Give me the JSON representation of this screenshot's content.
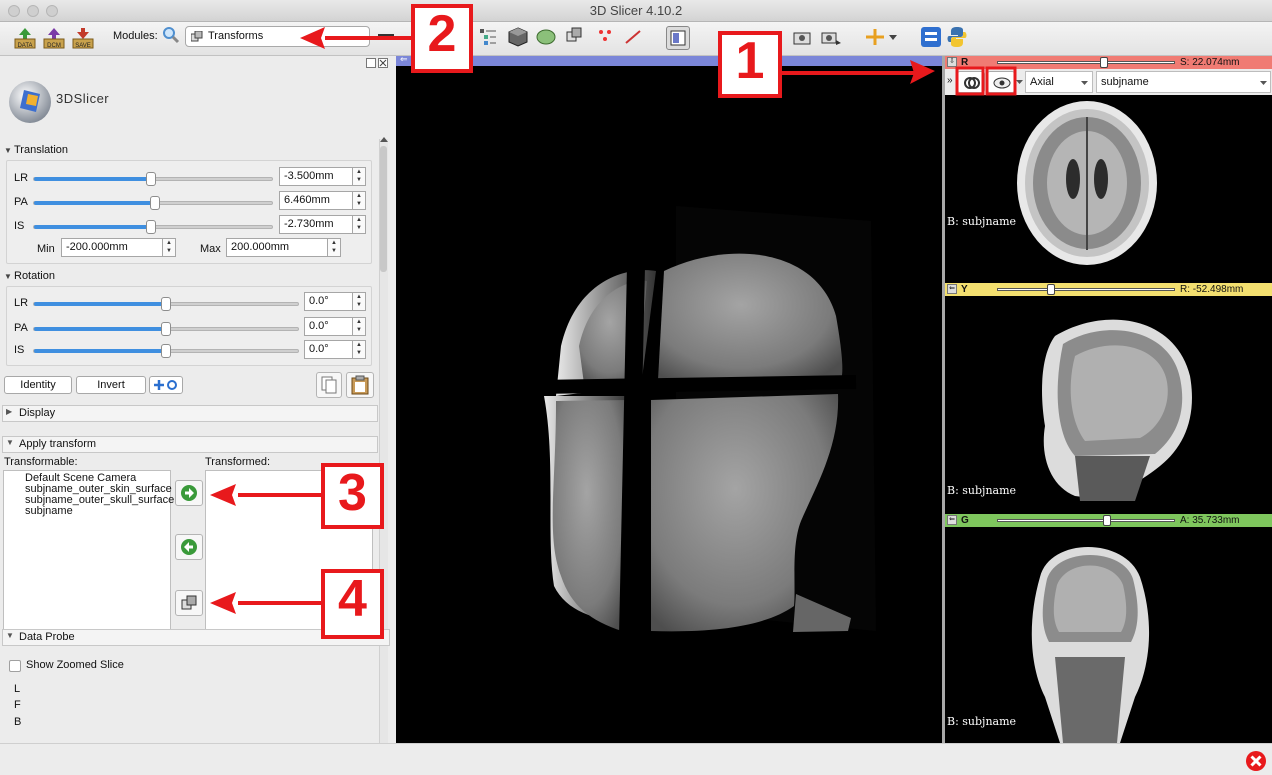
{
  "window": {
    "title": "3D Slicer 4.10.2"
  },
  "toolbar": {
    "buttons": [
      {
        "label": "DATA",
        "icon": "data-load-icon"
      },
      {
        "label": "DCM",
        "icon": "dicom-icon"
      },
      {
        "label": "SAVE",
        "icon": "save-icon"
      }
    ],
    "modules_label": "Modules:",
    "module_value": "Transforms"
  },
  "logo": {
    "text": "3DSlicer"
  },
  "translation": {
    "header": "Translation",
    "rows": [
      {
        "label": "LR",
        "value": "-3.500mm",
        "fraction": 0.49
      },
      {
        "label": "PA",
        "value": "6.460mm",
        "fraction": 0.51
      },
      {
        "label": "IS",
        "value": "-2.730mm",
        "fraction": 0.49
      }
    ],
    "min_label": "Min",
    "min_value": "-200.000mm",
    "max_label": "Max",
    "max_value": "200.000mm"
  },
  "rotation": {
    "header": "Rotation",
    "rows": [
      {
        "label": "LR",
        "value": "0.0°",
        "fraction": 0.5
      },
      {
        "label": "PA",
        "value": "0.0°",
        "fraction": 0.5
      },
      {
        "label": "IS",
        "value": "0.0°",
        "fraction": 0.5
      }
    ]
  },
  "actions": {
    "identity": "Identity",
    "invert": "Invert"
  },
  "display": {
    "header": "Display"
  },
  "apply": {
    "header": "Apply transform",
    "transformable_label": "Transformable:",
    "transformed_label": "Transformed:",
    "transformable_items": [
      "Default Scene Camera",
      "subjname_outer_skin_surface",
      "subjname_outer_skull_surface",
      "subjname"
    ]
  },
  "probe": {
    "header": "Data Probe",
    "show_zoomed": "Show Zoomed Slice",
    "coords": [
      "L",
      "F",
      "B"
    ]
  },
  "slice_controls": {
    "orientation": "Axial",
    "volume": "subjname"
  },
  "slices": [
    {
      "name": "R",
      "value": "S: 22.074mm",
      "color": "#f07b73",
      "label": "B: subjname",
      "fraction": 0.6
    },
    {
      "name": "Y",
      "value": "R: -52.498mm",
      "color": "#f3df6f",
      "label": "B: subjname",
      "fraction": 0.3
    },
    {
      "name": "G",
      "value": "A: 35.733mm",
      "color": "#7ec65d",
      "label": "B: subjname",
      "fraction": 0.62
    }
  ],
  "callouts": [
    "1",
    "2",
    "3",
    "4"
  ],
  "colors": {
    "accent": "#e8191c",
    "viewbar": "#7b86d8"
  }
}
